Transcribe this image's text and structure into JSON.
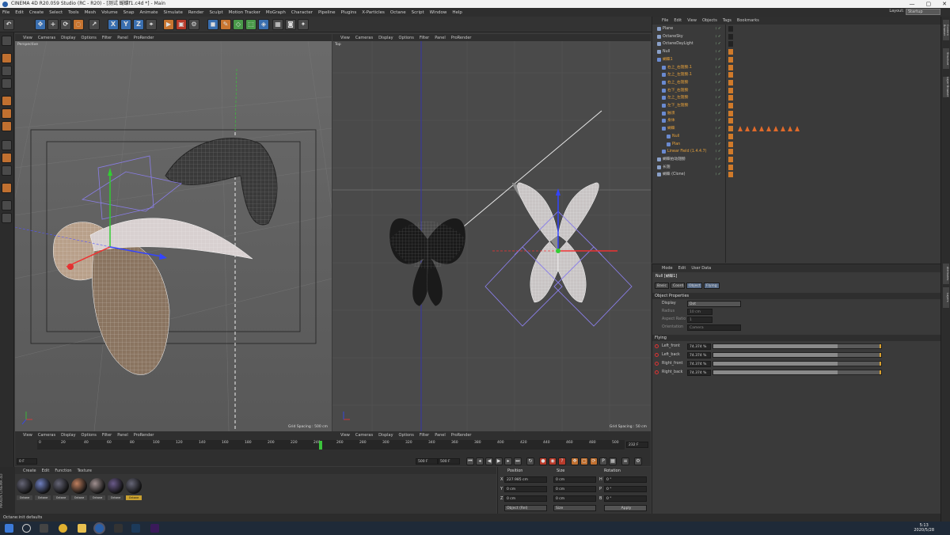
{
  "window": {
    "title": "CINEMA 4D R20.059 Studio (RC - R20) - [测试 蝴蝶f1.c4d *] - Main",
    "controls": [
      "—",
      "▢",
      "✕"
    ]
  },
  "menu": {
    "items": [
      "File",
      "Edit",
      "Create",
      "Select",
      "Tools",
      "Mesh",
      "Volume",
      "Snap",
      "Animate",
      "Simulate",
      "Render",
      "Sculpt",
      "Motion Tracker",
      "MoGraph",
      "Character",
      "Pipeline",
      "Plugins",
      "X-Particles",
      "Octane",
      "Script",
      "Window",
      "Help"
    ],
    "layout_label": "Layout:",
    "layout_value": "Startup"
  },
  "toolbar": {
    "undo": "↶",
    "axis_x": "X",
    "axis_y": "Y",
    "axis_z": "Z"
  },
  "viewport_left": {
    "menu": [
      "View",
      "Cameras",
      "Display",
      "Options",
      "Filter",
      "Panel",
      "ProRender"
    ],
    "label": "Perspective",
    "grid": "Grid Spacing : 500 cm"
  },
  "viewport_right": {
    "menu": [
      "View",
      "Cameras",
      "Display",
      "Options",
      "Filter",
      "Panel",
      "ProRender"
    ],
    "label": "Top",
    "grid": "Grid Spacing : 50 cm"
  },
  "viewport_bottom": {
    "menu_left": [
      "View",
      "Cameras",
      "Display",
      "Options",
      "Filter",
      "Panel",
      "ProRender"
    ],
    "menu_right": [
      "View",
      "Cameras",
      "Display",
      "Options",
      "Filter",
      "Panel",
      "ProRender"
    ]
  },
  "timeline": {
    "ticks": [
      "0",
      "20",
      "40",
      "60",
      "80",
      "100",
      "120",
      "140",
      "160",
      "180",
      "200",
      "220",
      "240",
      "260",
      "280",
      "300",
      "320",
      "340",
      "360",
      "380",
      "400",
      "420",
      "440",
      "460",
      "480",
      "500"
    ],
    "current_frame": "232 F",
    "start": "0 F",
    "end": "500 F",
    "max": "500 F"
  },
  "material_panel": {
    "menu": [
      "Create",
      "Edit",
      "Function",
      "Texture"
    ],
    "materials": [
      "Octane",
      "Octane",
      "Octane",
      "Octane",
      "Octane",
      "Octane",
      "Octane"
    ],
    "brand": "MAXON CINEMA 4D"
  },
  "coordinates": {
    "headers": [
      "Position",
      "Size",
      "Rotation"
    ],
    "rows": [
      {
        "axis": "X",
        "pos": "227.985 cm",
        "size": "0 cm",
        "rot_axis": "H",
        "rot": "0 °"
      },
      {
        "axis": "Y",
        "pos": "0 cm",
        "size": "0 cm",
        "rot_axis": "P",
        "rot": "0 °"
      },
      {
        "axis": "Z",
        "pos": "0 cm",
        "size": "0 cm",
        "rot_axis": "B",
        "rot": "0 °"
      }
    ],
    "mode": "Object (Rel)",
    "size_mode": "Size",
    "apply": "Apply"
  },
  "object_manager": {
    "menu": [
      "File",
      "Edit",
      "View",
      "Objects",
      "Tags",
      "Bookmarks"
    ],
    "rows": [
      {
        "name": "Plane",
        "indent": 0,
        "color": "#cccccc"
      },
      {
        "name": "OctaneSky",
        "indent": 0,
        "color": "#cccccc"
      },
      {
        "name": "OctaneDayLight",
        "indent": 0,
        "color": "#cccccc"
      },
      {
        "name": "Null",
        "indent": 0,
        "color": "#cccccc"
      },
      {
        "name": "蝴蝶1",
        "indent": 0,
        "color": "#e8a23a"
      },
      {
        "name": "右上_右翅膀.1",
        "indent": 1,
        "color": "#e8a23a"
      },
      {
        "name": "左上_左翅膀.1",
        "indent": 1,
        "color": "#e8a23a"
      },
      {
        "name": "右上_右翅膀",
        "indent": 1,
        "color": "#e8a23a"
      },
      {
        "name": "右下_右翅膀",
        "indent": 1,
        "color": "#e8a23a"
      },
      {
        "name": "左上_左翅膀",
        "indent": 1,
        "color": "#e8a23a"
      },
      {
        "name": "左下_左翅膀",
        "indent": 1,
        "color": "#e8a23a"
      },
      {
        "name": "触须",
        "indent": 1,
        "color": "#e8a23a"
      },
      {
        "name": "身体",
        "indent": 1,
        "color": "#e8a23a"
      },
      {
        "name": "蝴蝶",
        "indent": 1,
        "color": "#e8a23a"
      },
      {
        "name": "Null",
        "indent": 2,
        "color": "#e8a23a"
      },
      {
        "name": "Plan",
        "indent": 2,
        "color": "#e8a23a"
      },
      {
        "name": "Linear Field (1.4.4.7)",
        "indent": 1,
        "color": "#e8a23a"
      },
      {
        "name": "蝴蝶拍动翅膀",
        "indent": 0,
        "color": "#cccccc"
      },
      {
        "name": "长翅",
        "indent": 0,
        "color": "#cccccc"
      },
      {
        "name": "蝴蝶 (Clone)",
        "indent": 0,
        "color": "#cccccc"
      }
    ]
  },
  "attributes": {
    "menu": [
      "Mode",
      "Edit",
      "User Data"
    ],
    "object_title": "Null [蝴蝶1]",
    "tabs": [
      "Basic",
      "Coord.",
      "Object",
      "Flying"
    ],
    "section_object": "Object Properties",
    "display_label": "Display",
    "display_value": "Dot",
    "radius_label": "Radius",
    "radius_value": "10 cm",
    "aspect_label": "Aspect Ratio",
    "aspect_value": "1",
    "orientation_label": "Orientation",
    "orientation_value": "Camera",
    "section_flying": "Flying",
    "params": [
      {
        "name": "Left_front",
        "value": "74.374 %",
        "fraction": 0.74
      },
      {
        "name": "Left_back",
        "value": "74.374 %",
        "fraction": 0.74
      },
      {
        "name": "Right_front",
        "value": "74.374 %",
        "fraction": 0.74
      },
      {
        "name": "Right_back",
        "value": "74.374 %",
        "fraction": 0.74
      }
    ]
  },
  "right_strip": [
    "Content Browser",
    "Structure",
    "Layer Browser",
    "Attributes",
    "Layers"
  ],
  "status": "Octane:init defaults",
  "taskbar": {
    "time": "5:13",
    "date": "2020/5/28"
  }
}
